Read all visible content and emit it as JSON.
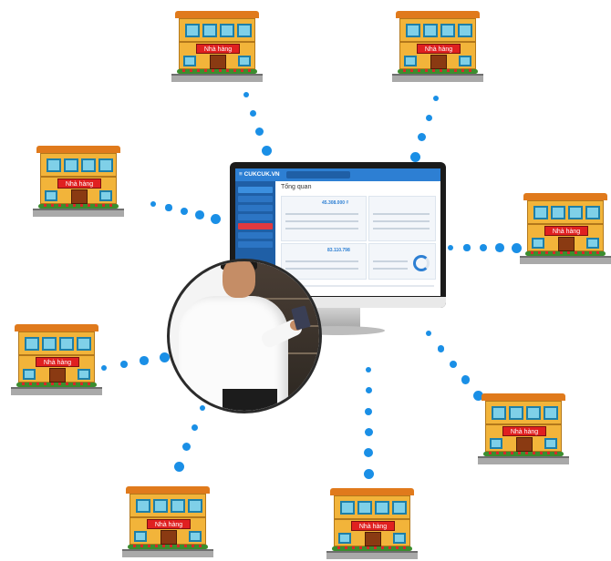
{
  "restaurant_sign": "Nhà hàng",
  "screen": {
    "logo": "≡ CUKCUK.VN",
    "title": "Tổng quan",
    "revenue_value": "45.308.000 ₫",
    "profit_value": "83.110.798"
  },
  "colors": {
    "dot": "#1a8fe6",
    "sign_red": "#e02020",
    "wall": "#f2b43a",
    "roof": "#e07a1c",
    "window": "#7fd0e8",
    "screen_header": "#2d7fd3"
  },
  "icons": [
    "restaurant-building",
    "monitor",
    "person-with-phone"
  ]
}
